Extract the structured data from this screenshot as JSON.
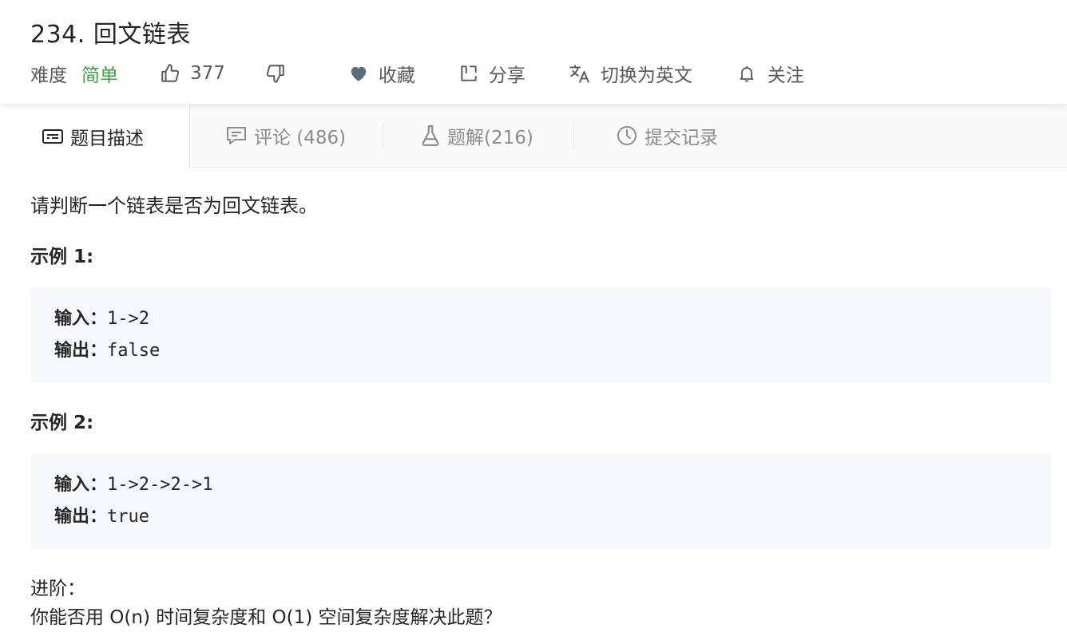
{
  "problem": {
    "title": "234. 回文链表",
    "difficulty_label": "难度",
    "difficulty": "简单"
  },
  "actions": {
    "likes": "377",
    "favorite": "收藏",
    "share": "分享",
    "switch_lang": "切换为英文",
    "follow": "关注"
  },
  "tabs": [
    {
      "label": "题目描述",
      "icon": "description-icon"
    },
    {
      "label": "评论 (486)",
      "icon": "comment-icon"
    },
    {
      "label": "题解(216)",
      "icon": "flask-icon"
    },
    {
      "label": "提交记录",
      "icon": "clock-icon"
    }
  ],
  "content": {
    "description": "请判断一个链表是否为回文链表。",
    "examples": [
      {
        "title": "示例 1:",
        "input_label": "输入：",
        "input": "1->2",
        "output_label": "输出：",
        "output": "false"
      },
      {
        "title": "示例 2:",
        "input_label": "输入：",
        "input": "1->2->2->1",
        "output_label": "输出：",
        "output": "true"
      }
    ],
    "advanced_title": "进阶：",
    "advanced_text": "你能否用 O(n) 时间复杂度和 O(1) 空间复杂度解决此题？"
  },
  "colors": {
    "easy": "#43a047",
    "text": "#262626",
    "muted": "#8c8c8c",
    "code_bg": "#f7f8fa"
  }
}
